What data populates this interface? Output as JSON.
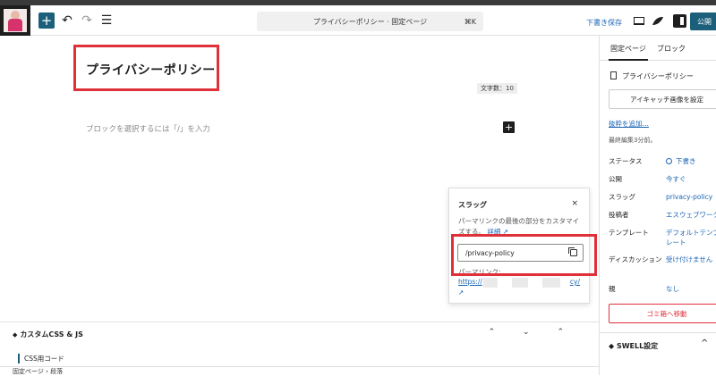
{
  "toolbar": {
    "add_icon": "plus-icon",
    "undo_icon": "undo-icon",
    "redo_icon": "redo-icon",
    "list_view_icon": "list-view-icon",
    "document_title": "プライバシーポリシー · 固定ページ",
    "shortcut": "⌘K",
    "save_draft": "下書き保存",
    "publish": "公開"
  },
  "editor": {
    "page_title": "プライバシーポリシー",
    "char_count": "文字数：10",
    "block_placeholder": "ブロックを選択するには「/」を入力",
    "inline_add": "+"
  },
  "slug_popover": {
    "title": "スラッグ",
    "close": "×",
    "description": "パーマリンクの最後の部分をカスタマイズする。",
    "details_link": "詳細 ↗",
    "slug_value": "/privacy-policy",
    "permalink_label": "パーマリンク:",
    "permalink_start": "https://",
    "permalink_end": "cy/",
    "external": "↗"
  },
  "meta_panel": {
    "title": "カスタムCSS & JS",
    "controls": "⌃ ⌄ ⌃",
    "sub_label": "CSS用コード"
  },
  "footer": {
    "breadcrumb": "固定ページ  ›  段落"
  },
  "sidebar": {
    "tabs": [
      "固定ページ",
      "ブロック"
    ],
    "doc_title": "プライバシーポリシー",
    "featured_image": "アイキャッチ画像を設定",
    "add_excerpt": "抜粋を追加…",
    "last_edited": "最終編集3分前。",
    "properties": [
      {
        "label": "ステータス",
        "value": "下書き"
      },
      {
        "label": "公開",
        "value": "今すぐ"
      },
      {
        "label": "スラッグ",
        "value": "privacy-policy"
      },
      {
        "label": "投稿者",
        "value": "エスウェブワーク"
      },
      {
        "label": "テンプレート",
        "value": "デフォルトテンプレート"
      },
      {
        "label": "ディスカッション",
        "value": "受け付けません"
      },
      {
        "label": "親",
        "value": "なし"
      }
    ],
    "trash": "ゴミ箱へ移動",
    "swell_settings": "SWELL設定",
    "swell_chevron": "^"
  },
  "colors": {
    "accent": "#1c5f7a",
    "link": "#1a64b4",
    "highlight": "#e0303a"
  }
}
